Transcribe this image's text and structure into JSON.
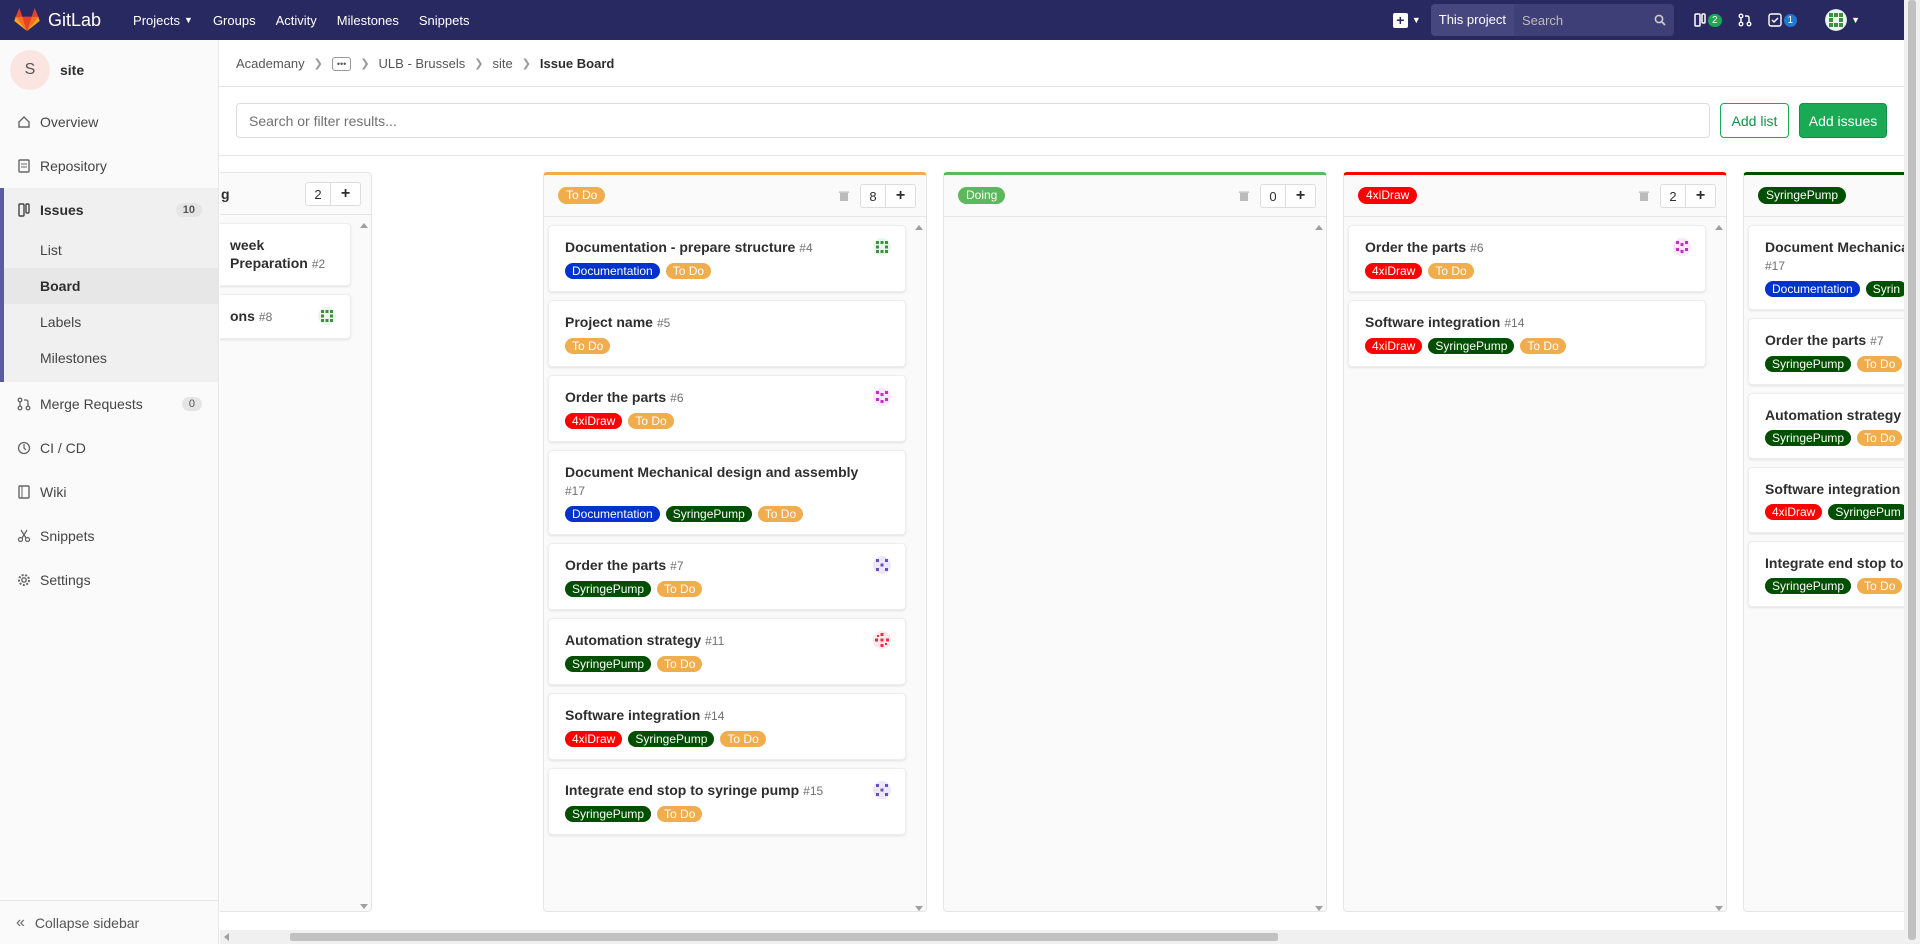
{
  "navbar": {
    "brand": "GitLab",
    "links": [
      "Projects",
      "Groups",
      "Activity",
      "Milestones",
      "Snippets"
    ],
    "scope": "This project",
    "search_placeholder": "Search",
    "issues_count": "2",
    "todo_count": "1"
  },
  "sidebar": {
    "avatar_letter": "S",
    "project": "site",
    "items": {
      "overview": "Overview",
      "repository": "Repository",
      "issues": "Issues",
      "issues_count": "10",
      "list": "List",
      "board": "Board",
      "labels": "Labels",
      "milestones": "Milestones",
      "merge_requests": "Merge Requests",
      "mr_count": "0",
      "cicd": "CI / CD",
      "wiki": "Wiki",
      "snippets": "Snippets",
      "settings": "Settings"
    },
    "collapse": "Collapse sidebar"
  },
  "breadcrumb": {
    "a": "Academany",
    "b": "ULB - Brussels",
    "c": "site",
    "current": "Issue Board"
  },
  "toolbar": {
    "filter_placeholder": "Search or filter results...",
    "add_list": "Add list",
    "add_issues": "Add issues"
  },
  "colors": {
    "todo": "#f0ad4e",
    "doing": "#5cb85c",
    "xidraw": "#ff0000",
    "syringe": "#004e00",
    "documentation": "#0033cc"
  },
  "lists": {
    "backlog": {
      "title_fragment": "g",
      "count": "2",
      "cards": [
        {
          "title": " week Preparation",
          "num": "#2"
        },
        {
          "title": "ons",
          "num": "#8"
        }
      ]
    },
    "todo": {
      "label": "To Do",
      "count": "8",
      "cards": [
        {
          "title": "Documentation - prepare structure",
          "num": "#4",
          "labels": [
            "Documentation",
            "To Do"
          ]
        },
        {
          "title": "Project name",
          "num": "#5",
          "labels": [
            "To Do"
          ]
        },
        {
          "title": "Order the parts",
          "num": "#6",
          "labels": [
            "4xiDraw",
            "To Do"
          ]
        },
        {
          "title": "Document Mechanical design and assembly",
          "num": "#17",
          "labels": [
            "Documentation",
            "SyringePump",
            "To Do"
          ]
        },
        {
          "title": "Order the parts",
          "num": "#7",
          "labels": [
            "SyringePump",
            "To Do"
          ]
        },
        {
          "title": "Automation strategy",
          "num": "#11",
          "labels": [
            "SyringePump",
            "To Do"
          ]
        },
        {
          "title": "Software integration",
          "num": "#14",
          "labels": [
            "4xiDraw",
            "SyringePump",
            "To Do"
          ]
        },
        {
          "title": "Integrate end stop to syringe pump",
          "num": "#15",
          "labels": [
            "SyringePump",
            "To Do"
          ]
        }
      ]
    },
    "doing": {
      "label": "Doing",
      "count": "0"
    },
    "xidraw": {
      "label": "4xiDraw",
      "count": "2",
      "cards": [
        {
          "title": "Order the parts",
          "num": "#6",
          "labels": [
            "4xiDraw",
            "To Do"
          ]
        },
        {
          "title": "Software integration",
          "num": "#14",
          "labels": [
            "4xiDraw",
            "SyringePump",
            "To Do"
          ]
        }
      ]
    },
    "syringe": {
      "label": "SyringePump",
      "cards": [
        {
          "title": "Document Mechanica",
          "num": "#17",
          "labels": [
            "Documentation",
            "Syrin"
          ]
        },
        {
          "title": "Order the parts",
          "num": "#7",
          "labels": [
            "SyringePump",
            "To Do"
          ]
        },
        {
          "title": "Automation strategy",
          "num": "",
          "labels": [
            "SyringePump",
            "To Do"
          ]
        },
        {
          "title": "Software integration",
          "num": "",
          "labels": [
            "4xiDraw",
            "SyringePum"
          ]
        },
        {
          "title": "Integrate end stop to",
          "num": "",
          "labels": [
            "SyringePump",
            "To Do"
          ]
        }
      ]
    }
  }
}
